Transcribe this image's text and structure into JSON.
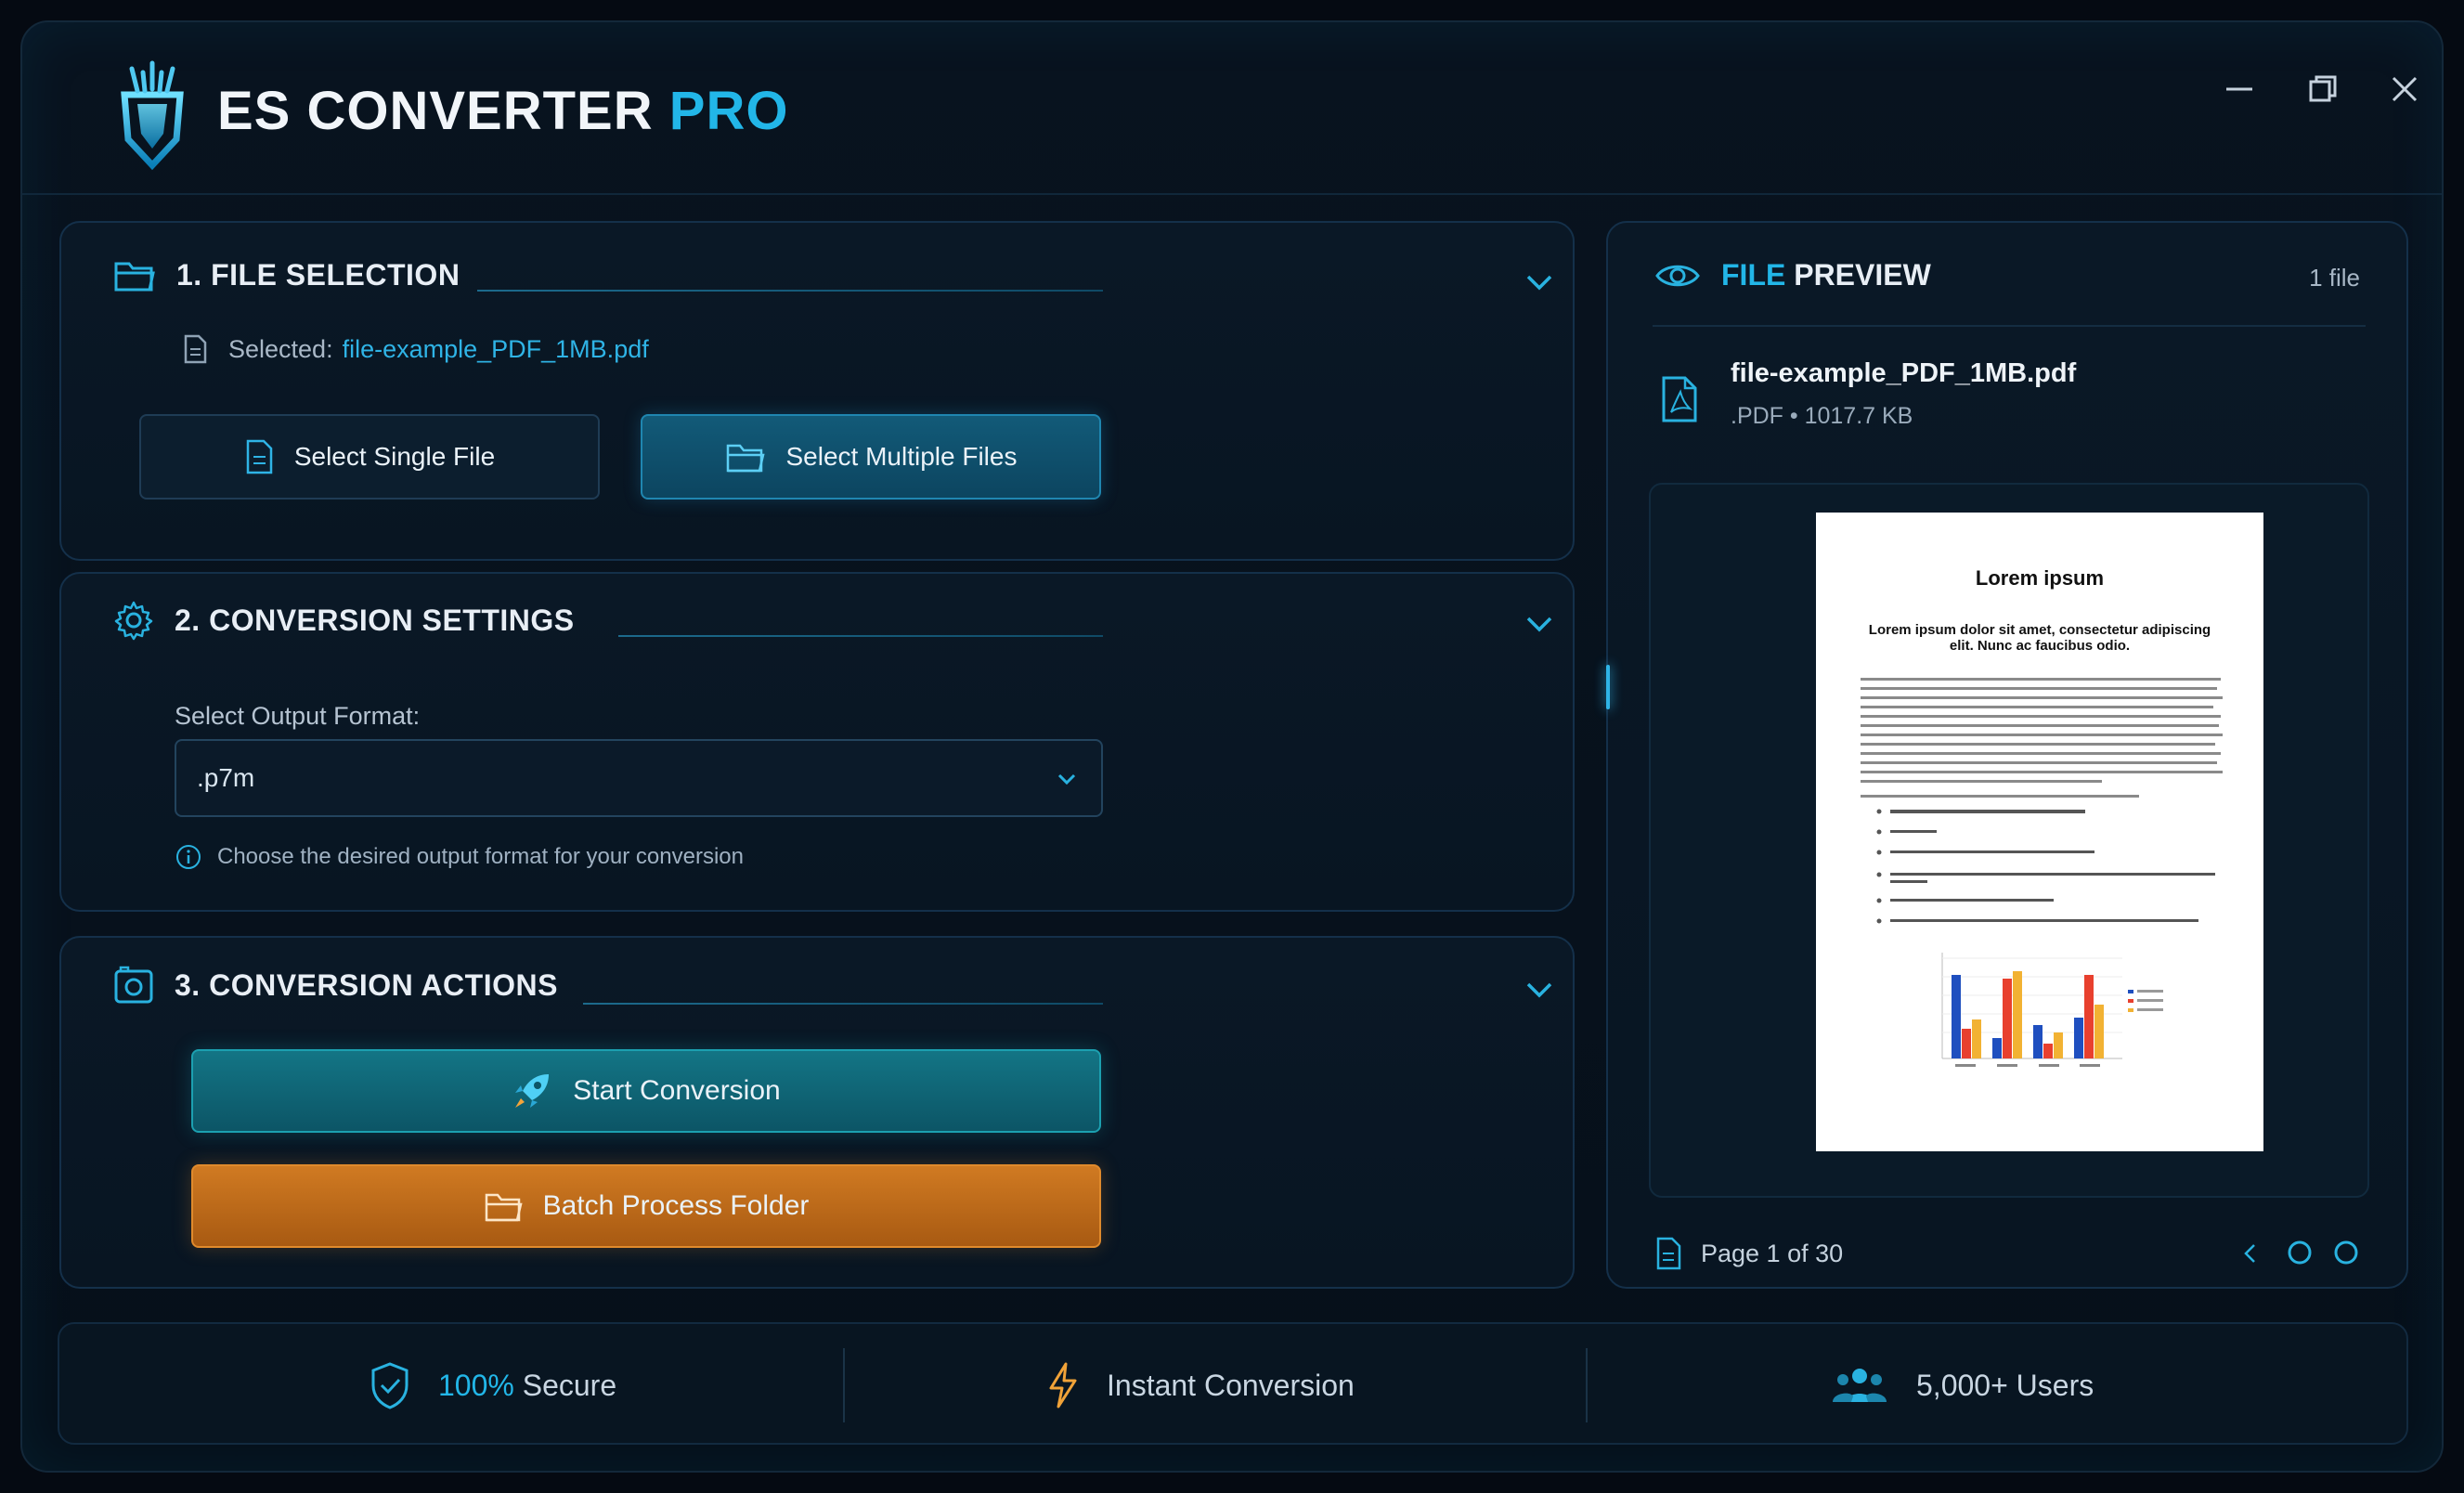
{
  "app": {
    "title_main": "ES CONVERTER",
    "title_accent": "PRO"
  },
  "colors": {
    "accent": "#22b6e8",
    "orange": "#c8741e",
    "teal_button": "#0f5d73",
    "background": "#07111c"
  },
  "file_selection": {
    "title": "1. FILE SELECTION",
    "selected_label": "Selected:",
    "selected_file": "file-example_PDF_1MB.pdf",
    "single_button": "Select Single File",
    "multiple_button": "Select Multiple Files"
  },
  "conversion_settings": {
    "title": "2. CONVERSION SETTINGS",
    "format_label": "Select Output Format:",
    "format_value": ".p7m",
    "hint": "Choose the desired output format for your conversion"
  },
  "conversion_actions": {
    "title": "3. CONVERSION ACTIONS",
    "start_button": "Start Conversion",
    "batch_button": "Batch Process Folder"
  },
  "preview": {
    "title_accent": "FILE",
    "title_rest": " PREVIEW",
    "count": "1 file",
    "file_name": "file-example_PDF_1MB.pdf",
    "file_meta": ".PDF • 1017.7 KB",
    "page_info": "Page 1 of 30",
    "document": {
      "title": "Lorem ipsum",
      "subtitle": "Lorem ipsum dolor sit amet, consectetur adipiscing elit. Nunc ac faucibus odio."
    }
  },
  "footer": {
    "secure_accent": "100%",
    "secure_rest": " Secure",
    "instant": "Instant Conversion",
    "users": "5,000+ Users"
  },
  "icons": [
    "logo-icon",
    "minimize-icon",
    "maximize-icon",
    "close-icon",
    "folder-icon",
    "file-icon",
    "chevron-down-icon",
    "gear-icon",
    "camera-icon",
    "rocket-icon",
    "eye-icon",
    "pdf-icon",
    "chevron-left-icon",
    "shield-icon",
    "bolt-icon",
    "users-icon",
    "info-icon"
  ]
}
